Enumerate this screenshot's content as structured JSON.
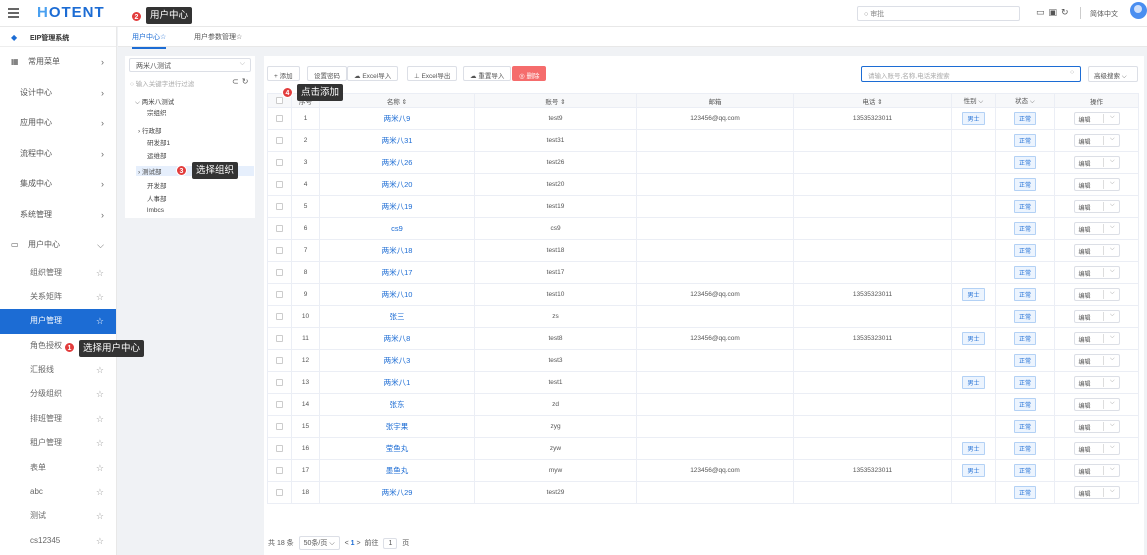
{
  "header": {
    "logo": "HOTENT",
    "logo_h": "H",
    "logo_rest": "OTENT",
    "search_placeholder": "审批",
    "lang": "简体中文"
  },
  "sidebar": {
    "system": "EIP管理系统",
    "menus": [
      "常用菜单",
      "设计中心",
      "应用中心",
      "流程中心",
      "集成中心",
      "系统管理",
      "用户中心"
    ],
    "subs": [
      "组织管理",
      "关系矩阵",
      "用户管理",
      "角色授权",
      "汇报线",
      "分级组织",
      "排班管理",
      "租户管理",
      "表单",
      "abc",
      "测试",
      "cs12345"
    ],
    "active_sub": "用户管理"
  },
  "tabs": [
    "用户中心☆",
    "用户参数管理☆"
  ],
  "tree": {
    "select": "两米八测试",
    "search_placeholder": "输入关键字进行过滤",
    "nodes": [
      "两米八测试",
      "宗组织",
      "行政部",
      "研发部1",
      "运维部",
      "测试部",
      "开发部",
      "人事部",
      "lmbcs"
    ],
    "selected": "测试部"
  },
  "toolbar": {
    "add": "+ 添加",
    "setting": "设置密码",
    "excel_import": "Excel导入",
    "excel_export": "Excel导出",
    "hr_import": "重置导入",
    "delete": "删除",
    "search_placeholder": "请输入账号,名称,电话来搜索",
    "advanced": "高级搜索"
  },
  "table": {
    "headers": [
      "序号",
      "名称",
      "账号",
      "邮箱",
      "电话",
      "性别",
      "状态",
      "操作"
    ],
    "rows": [
      [
        "1",
        "两米八9",
        "test9",
        "123456@qq.com",
        "13535323011",
        "男士",
        "正常"
      ],
      [
        "2",
        "两米八31",
        "test31",
        "",
        "",
        "",
        "正常"
      ],
      [
        "3",
        "两米八26",
        "test26",
        "",
        "",
        "",
        "正常"
      ],
      [
        "4",
        "两米八20",
        "test20",
        "",
        "",
        "",
        "正常"
      ],
      [
        "5",
        "两米八19",
        "test19",
        "",
        "",
        "",
        "正常"
      ],
      [
        "6",
        "cs9",
        "cs9",
        "",
        "",
        "",
        "正常"
      ],
      [
        "7",
        "两米八18",
        "test18",
        "",
        "",
        "",
        "正常"
      ],
      [
        "8",
        "两米八17",
        "test17",
        "",
        "",
        "",
        "正常"
      ],
      [
        "9",
        "两米八10",
        "test10",
        "123456@qq.com",
        "13535323011",
        "男士",
        "正常"
      ],
      [
        "10",
        "张三",
        "zs",
        "",
        "",
        "",
        "正常"
      ],
      [
        "11",
        "两米八8",
        "test8",
        "123456@qq.com",
        "13535323011",
        "男士",
        "正常"
      ],
      [
        "12",
        "两米八3",
        "test3",
        "",
        "",
        "",
        "正常"
      ],
      [
        "13",
        "两米八1",
        "test1",
        "",
        "",
        "男士",
        "正常"
      ],
      [
        "14",
        "张东",
        "zd",
        "",
        "",
        "",
        "正常"
      ],
      [
        "15",
        "张宇果",
        "zyg",
        "",
        "",
        "",
        "正常"
      ],
      [
        "16",
        "莹鱼丸",
        "zyw",
        "",
        "",
        "男士",
        "正常"
      ],
      [
        "17",
        "墨鱼丸",
        "myw",
        "123456@qq.com",
        "13535323011",
        "男士",
        "正常"
      ],
      [
        "18",
        "两米八29",
        "test29",
        "",
        "",
        "",
        "正常"
      ]
    ],
    "op_label": "编辑"
  },
  "pager": {
    "total": "共 18 条",
    "size": "50条/页",
    "page": "1",
    "goto": "前往",
    "unit": "页"
  },
  "callouts": [
    {
      "n": "1",
      "text": "选择用户中心"
    },
    {
      "n": "2",
      "text": "用户中心"
    },
    {
      "n": "3",
      "text": "选择组织"
    },
    {
      "n": "4",
      "text": "点击添加"
    }
  ]
}
